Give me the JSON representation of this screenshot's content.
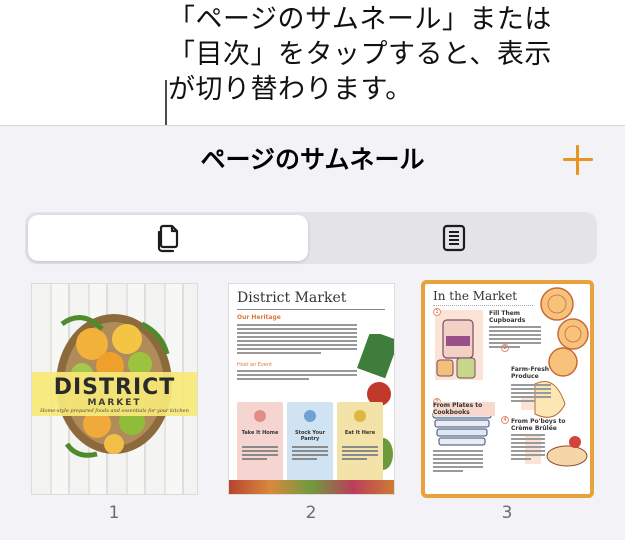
{
  "callout": {
    "text": "「ページのサムネール」または\n「目次」をタップすると、表示\nが切り替わります。"
  },
  "panel": {
    "title": "ページのサムネール",
    "add_icon": "plus-icon",
    "segments": [
      {
        "icon": "page-thumbnails-icon",
        "selected": true
      },
      {
        "icon": "table-of-contents-icon",
        "selected": false
      }
    ],
    "accent_color": "#e7951f",
    "selection_color": "#e8a13c"
  },
  "pages": [
    {
      "number": "1",
      "title": "DISTRICT",
      "subtitle": "MARKET",
      "tagline": "Home-style prepared foods and essentials for your kitchen"
    },
    {
      "number": "2",
      "title": "District Market",
      "heading": "Our Heritage",
      "subheading": "Host an Event",
      "cards": [
        "Take It Home",
        "Stock Your Pantry",
        "Eat It Here"
      ]
    },
    {
      "number": "3",
      "title": "In the Market",
      "sections": [
        "Fill Them Cupboards",
        "Farm-Fresh Produce",
        "From Plates to Cookbooks",
        "From Po'boys to Crème Brûlée"
      ],
      "selected": true
    }
  ]
}
